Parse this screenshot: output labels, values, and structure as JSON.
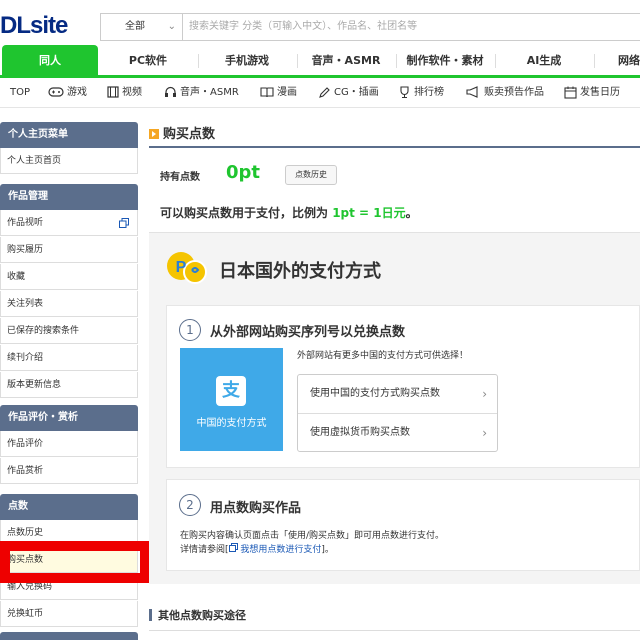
{
  "header": {
    "logo_main": "DL",
    "logo_site": "site",
    "search_category": "全部",
    "search_placeholder": "搜索关键字 分类（可输入中文）、作品名、社团名等"
  },
  "category_tabs": [
    "同人",
    "PC软件",
    "手机游戏",
    "音声・ASMR",
    "制作软件・素材",
    "AI生成",
    "网络"
  ],
  "subnav": [
    "TOP",
    "游戏",
    "视频",
    "音声・ASMR",
    "漫画",
    "CG・插画",
    "排行榜",
    "贩卖预告作品",
    "发售日历"
  ],
  "sidebar": {
    "groups": [
      {
        "title": "个人主页菜单",
        "items": [
          "个人主页首页"
        ]
      },
      {
        "title": "作品管理",
        "items": [
          "作品视听",
          "购买履历",
          "收藏",
          "关注列表",
          "已保存的搜索条件",
          "续刊介绍",
          "版本更新信息"
        ]
      },
      {
        "title": "作品评价・赏析",
        "items": [
          "作品评价",
          "作品赏析"
        ]
      },
      {
        "title": "点数",
        "items": [
          "点数历史",
          "购买点数",
          "输入兑换码",
          "兑换虹币"
        ]
      }
    ]
  },
  "main": {
    "title": "购买点数",
    "hold_label": "持有点数",
    "hold_value": "0pt",
    "history_button": "点数历史",
    "explain_prefix": "可以购买点数用于支付，比例为",
    "explain_rate": "1pt = 1日元",
    "explain_suffix": "。",
    "pay_title": "日本国外的支付方式",
    "step1_num": "1",
    "step1_title": "从外部网站购买序列号以兑换点数",
    "cn_tile_icon": "支",
    "cn_tile_label": "中国的支付方式",
    "step1_note": "外部网站有更多中国的支付方式可供选择！",
    "option1": "使用中国的支付方式购买点数",
    "option2": "使用虚拟货币购买点数",
    "step2_num": "2",
    "step2_title": "用点数购买作品",
    "step2_text1": "在购买内容确认页面点击「使用/购买点数」即可用点数进行支付。",
    "step2_text2_prefix": "详情请参阅[",
    "step2_link": "我想用点数进行支付",
    "step2_text2_suffix": "]。",
    "other_title": "其他点数购买途径"
  },
  "colors": {
    "brand_green": "#1fc52f",
    "sidebar_head": "#5b6e8c",
    "alipay_blue": "#3fa9e8",
    "highlight_red": "#ee0000"
  }
}
